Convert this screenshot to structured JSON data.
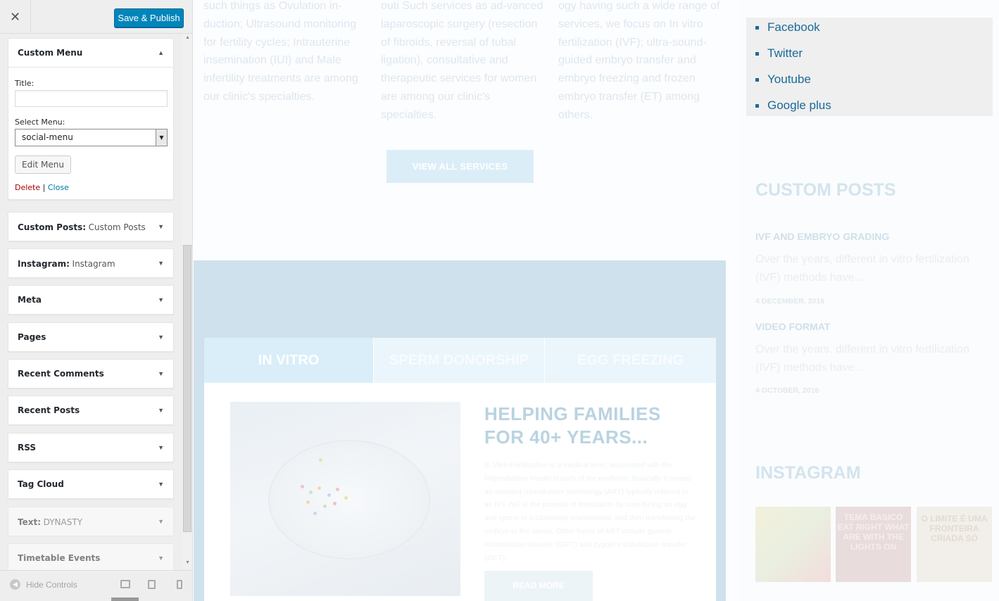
{
  "customizer": {
    "close_glyph": "✕",
    "publish_label": "Save & Publish",
    "open_widget": {
      "title": "Custom Menu",
      "title_label": "Title:",
      "title_value": "",
      "select_menu_label": "Select Menu:",
      "select_menu_value": "social-menu",
      "edit_menu_label": "Edit Menu",
      "delete_label": "Delete",
      "separator": "|",
      "close_label": "Close"
    },
    "widgets": [
      {
        "name": "Custom Posts:",
        "subtitle": "Custom Posts"
      },
      {
        "name": "Instagram:",
        "subtitle": "Instagram"
      },
      {
        "name": "Meta",
        "subtitle": ""
      },
      {
        "name": "Pages",
        "subtitle": ""
      },
      {
        "name": "Recent Comments",
        "subtitle": ""
      },
      {
        "name": "Recent Posts",
        "subtitle": ""
      },
      {
        "name": "RSS",
        "subtitle": ""
      },
      {
        "name": "Tag Cloud",
        "subtitle": ""
      },
      {
        "name": "Text:",
        "subtitle": "DYNASTY"
      },
      {
        "name": "Timetable Events",
        "subtitle": ""
      }
    ],
    "hide_controls_label": "Hide Controls",
    "icons": [
      "close-icon",
      "chevron-up-icon",
      "chevron-down-icon",
      "hide-controls-icon",
      "desktop-icon",
      "tablet-icon",
      "mobile-icon"
    ]
  },
  "preview": {
    "services": [
      "such things as Ovulation in-duction; Ultrasound monitoring for fertility cycles; Intrauterine insemination (IUI) and Male infertility treatments are among our clinic's specialties.",
      "outi Such services as ad-vanced laparoscopic surgery (resection of fibroids, reversal of tubal ligation), consultative and therapeutic services for women are among our clinic's specialties.",
      "ogy having such a wide range of services, we focus on In vitro fertilization (IVF); ultra-sound-guided embryo transfer and embryo freezing and frozen embryo transfer (ET) among others."
    ],
    "view_all_label": "VIEW ALL SERVICES",
    "tabs": [
      "IN VITRO",
      "SPERM DONORSHIP",
      "EGG FREEZING"
    ],
    "help_title": "HELPING FAMILIES FOR 40+ YEARS...",
    "help_body": "In Vitro Fertilization is a medical term, associated with the Reproductive Health branch of the medicine. Basically it means an assisted reproductive technology (ART) typically referred to as IVF. IVF is the process of fertilization by com-bining an egg and sperm in a laboratory environment, and then transferring the embryo to the uterus. Other forms of ART include gamete intrafallopian transfer (GIFT) and zygote intrafallopian transfer (ZIFT).",
    "read_more_label": "READ MORE"
  },
  "sidebar": {
    "social_links": [
      "Facebook",
      "Twitter",
      "Youtube",
      "Google plus"
    ],
    "custom_posts_heading": "CUSTOM POSTS",
    "posts": [
      {
        "title": "IVF AND EMBRYO GRADING",
        "excerpt": "Over the years, different in vitro fertilization (IVF) methods have...",
        "date": "4 DECEMBER, 2016"
      },
      {
        "title": "VIDEO FORMAT",
        "excerpt": "Over the years, different in vitro fertilization (IVF) methods have...",
        "date": "4 OCTOBER, 2016"
      }
    ],
    "instagram_heading": "INSTAGRAM",
    "instagram_texts": [
      "",
      "TEMA BASICO EAT RIGHT WHAT ARE WITH THE LIGHTS ON",
      "O LIMITE É UMA FRONTEIRA CRIADA SÓ"
    ]
  },
  "colors": {
    "publish_blue": "#0085ba",
    "link_blue": "#0073aa",
    "delete_red": "#a00",
    "social_link": "#1a6a99"
  }
}
